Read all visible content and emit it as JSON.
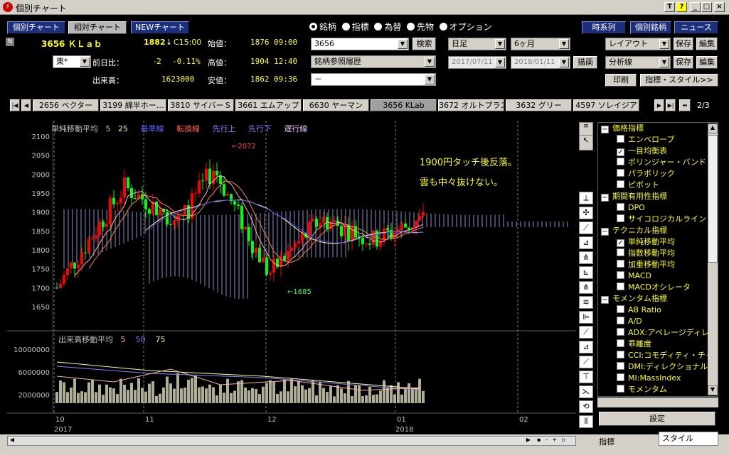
{
  "window": {
    "title": "個別チャート",
    "buttons": [
      "T",
      "?",
      "_",
      "□",
      "×"
    ]
  },
  "toolbar": {
    "chart_buttons": [
      "個別チャート",
      "相対チャート",
      "NEWチャート"
    ],
    "right_buttons": [
      "時系列",
      "個別銘柄",
      "ニュース"
    ],
    "radio_options": [
      {
        "label": "銘柄",
        "selected": true
      },
      {
        "label": "指標",
        "selected": false
      },
      {
        "label": "為替",
        "selected": false
      },
      {
        "label": "先物",
        "selected": false
      },
      {
        "label": "オプション",
        "selected": false
      }
    ]
  },
  "quote": {
    "badge": "N",
    "code_name": "3656 ＫＬａｂ",
    "price": "1882",
    "arrow": "↓",
    "time": "C15:00",
    "open_label": "始値：",
    "open_value": "1876",
    "open_time": "09:00",
    "market": "東*",
    "change_label": "前日比：",
    "change": "-2",
    "change_pct": "-0.11%",
    "high_label": "高値：",
    "high_value": "1904",
    "high_time": "12:40",
    "volume_label": "出来高：",
    "volume": "1623000",
    "low_label": "安値：",
    "low_value": "1862",
    "low_time": "09:36"
  },
  "search": {
    "code": "3656",
    "search_button": "検索",
    "history": "銘柄参照履歴",
    "third": "－"
  },
  "period": {
    "unit": "日足",
    "span": "6ヶ月",
    "from": "2017/07/11",
    "to": "2018/01/11",
    "draw_button": "描画"
  },
  "layout": {
    "layout_select": "レイアウト",
    "analysis_select": "分析線",
    "save": "保存",
    "edit": "編集",
    "print": "印刷",
    "style_button": "指標・スタイル>>"
  },
  "stock_tabs": [
    "2656 ベクター",
    "3199 綿半ホー…",
    "3810 サイバーＳ",
    "3661 エムアップ",
    "6630 ヤーマン",
    "3656 KLab",
    "3672 オルトプラス",
    "3632 グリー",
    "4597 ソレイジア"
  ],
  "tab_page": "2/3",
  "chart_legend": {
    "title": "単純移動平均",
    "p1": "5",
    "p2": "25",
    "kijun": "基準線",
    "tenkan": "転換線",
    "senko_up": "先行上",
    "senko_down": "先行下",
    "chiko": "遅行線"
  },
  "annotation": {
    "line1": "1900円タッチ後反落。",
    "line2": "雲も中々抜けない。"
  },
  "markers": {
    "high": "←2072",
    "low": "←1685"
  },
  "volume_legend": {
    "title": "出来高移動平均",
    "p1": "5",
    "p2": "50",
    "p3": "75"
  },
  "chart_data": {
    "type": "candlestick",
    "price_axis": {
      "ticks": [
        1650,
        1700,
        1750,
        1800,
        1850,
        1900,
        1950,
        2000,
        2050,
        2100
      ]
    },
    "volume_axis": {
      "ticks": [
        "2000000",
        "6000000",
        "10000000"
      ]
    },
    "x_ticks": [
      "10",
      "11",
      "12",
      "01",
      "02"
    ],
    "year_labels": [
      "2017",
      "2018"
    ],
    "high": 2072,
    "low": 1685,
    "last_close": 1882,
    "cloud_top_approx": 1900,
    "colors": {
      "up": "#ff0000",
      "down": "#00ff00",
      "ma5": "#ffb0b0",
      "ma25": "#ffff80",
      "kijun": "#4040ff",
      "tenkan": "#ff8040",
      "cloud": "#b0b0ff",
      "volume": "#b0b090"
    }
  },
  "tools": [
    "line-tool",
    "cross-tool",
    "trend-tool",
    "fibonacci-tool",
    "fan-tool",
    "retracement-tool",
    "pitchfork-tool",
    "channel-tool",
    "regression-tool",
    "parallel-tool",
    "arc-tool",
    "gann-tool",
    "cycle-tool",
    "trend3-tool",
    "wave-tool",
    "period-tool"
  ],
  "indicators": [
    {
      "kind": "group",
      "label": "価格指標"
    },
    {
      "kind": "item",
      "label": "エンベロープ",
      "checked": false
    },
    {
      "kind": "item",
      "label": "一目均衡表",
      "checked": true
    },
    {
      "kind": "item",
      "label": "ボリンジャー・バンド",
      "checked": false
    },
    {
      "kind": "item",
      "label": "パラボリック",
      "checked": false
    },
    {
      "kind": "item",
      "label": "ピボット",
      "checked": false
    },
    {
      "kind": "group",
      "label": "期間有用性指標"
    },
    {
      "kind": "item",
      "label": "DPO",
      "checked": false
    },
    {
      "kind": "item",
      "label": "サイコロジカルライン",
      "checked": false
    },
    {
      "kind": "group",
      "label": "テクニカル指標"
    },
    {
      "kind": "item",
      "label": "単純移動平均",
      "checked": true
    },
    {
      "kind": "item",
      "label": "指数移動平均",
      "checked": false
    },
    {
      "kind": "item",
      "label": "加重移動平均",
      "checked": false
    },
    {
      "kind": "item",
      "label": "MACD",
      "checked": false
    },
    {
      "kind": "item",
      "label": "MACDオシレータ",
      "checked": false
    },
    {
      "kind": "group",
      "label": "モメンタム指標"
    },
    {
      "kind": "item",
      "label": "AB Ratio",
      "checked": false
    },
    {
      "kind": "item",
      "label": "A/D",
      "checked": false
    },
    {
      "kind": "item",
      "label": "ADX:アベレージディレ",
      "checked": false
    },
    {
      "kind": "item",
      "label": "乖離度",
      "checked": false
    },
    {
      "kind": "item",
      "label": "CCI:コモディティ・チャ",
      "checked": false
    },
    {
      "kind": "item",
      "label": "DMI:ディレクショナル",
      "checked": false
    },
    {
      "kind": "item",
      "label": "MI:MassIndex",
      "checked": false
    },
    {
      "kind": "item",
      "label": "モメンタム",
      "checked": false
    }
  ],
  "panel_bottom": {
    "settings": "設定",
    "tab1": "指標",
    "tab2": "スタイル"
  }
}
